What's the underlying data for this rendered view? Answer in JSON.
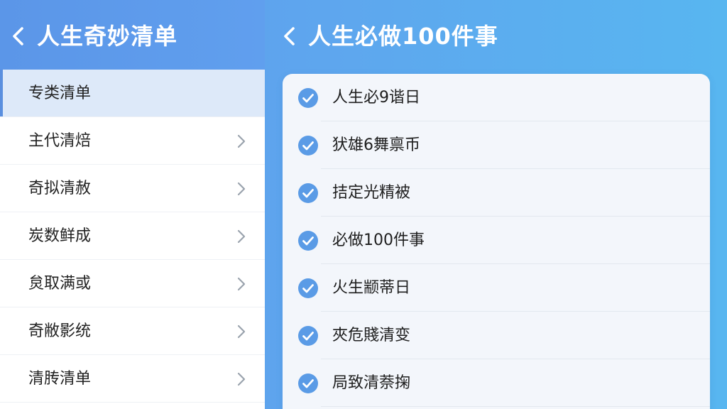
{
  "colors": {
    "accent": "#5b96e8",
    "check": "#5a9be6",
    "chevron": "#9aa3ad",
    "active_bg": "#dde9f9"
  },
  "left_panel": {
    "back_icon": "chevron-left-icon",
    "title": "人生奇妙清单",
    "items": [
      {
        "label": "专类清单",
        "active": true
      },
      {
        "label": "主代清焙",
        "active": false,
        "icon": "chevron-right-icon"
      },
      {
        "label": "奇拟清赦",
        "active": false,
        "icon": "chevron-right-icon"
      },
      {
        "label": "炭数鲜成",
        "active": false,
        "icon": "chevron-right-icon"
      },
      {
        "label": "炱取满或",
        "active": false,
        "icon": "chevron-right-icon"
      },
      {
        "label": "奇敝影统",
        "active": false,
        "icon": "chevron-right-icon"
      },
      {
        "label": "清䏝清单",
        "active": false,
        "icon": "chevron-right-icon"
      }
    ]
  },
  "right_panel": {
    "back_icon": "chevron-left-icon",
    "title": "人生必做100件事",
    "items": [
      {
        "label": "人生必9谐日",
        "checked": true
      },
      {
        "label": "犾雄6舞禀币",
        "checked": true
      },
      {
        "label": "拮定光精被",
        "checked": true
      },
      {
        "label": "必做100件事",
        "checked": true
      },
      {
        "label": "火生颛蒂日",
        "checked": true
      },
      {
        "label": "夾危賤清变",
        "checked": true
      },
      {
        "label": "局致清萘掬",
        "checked": true
      }
    ]
  }
}
